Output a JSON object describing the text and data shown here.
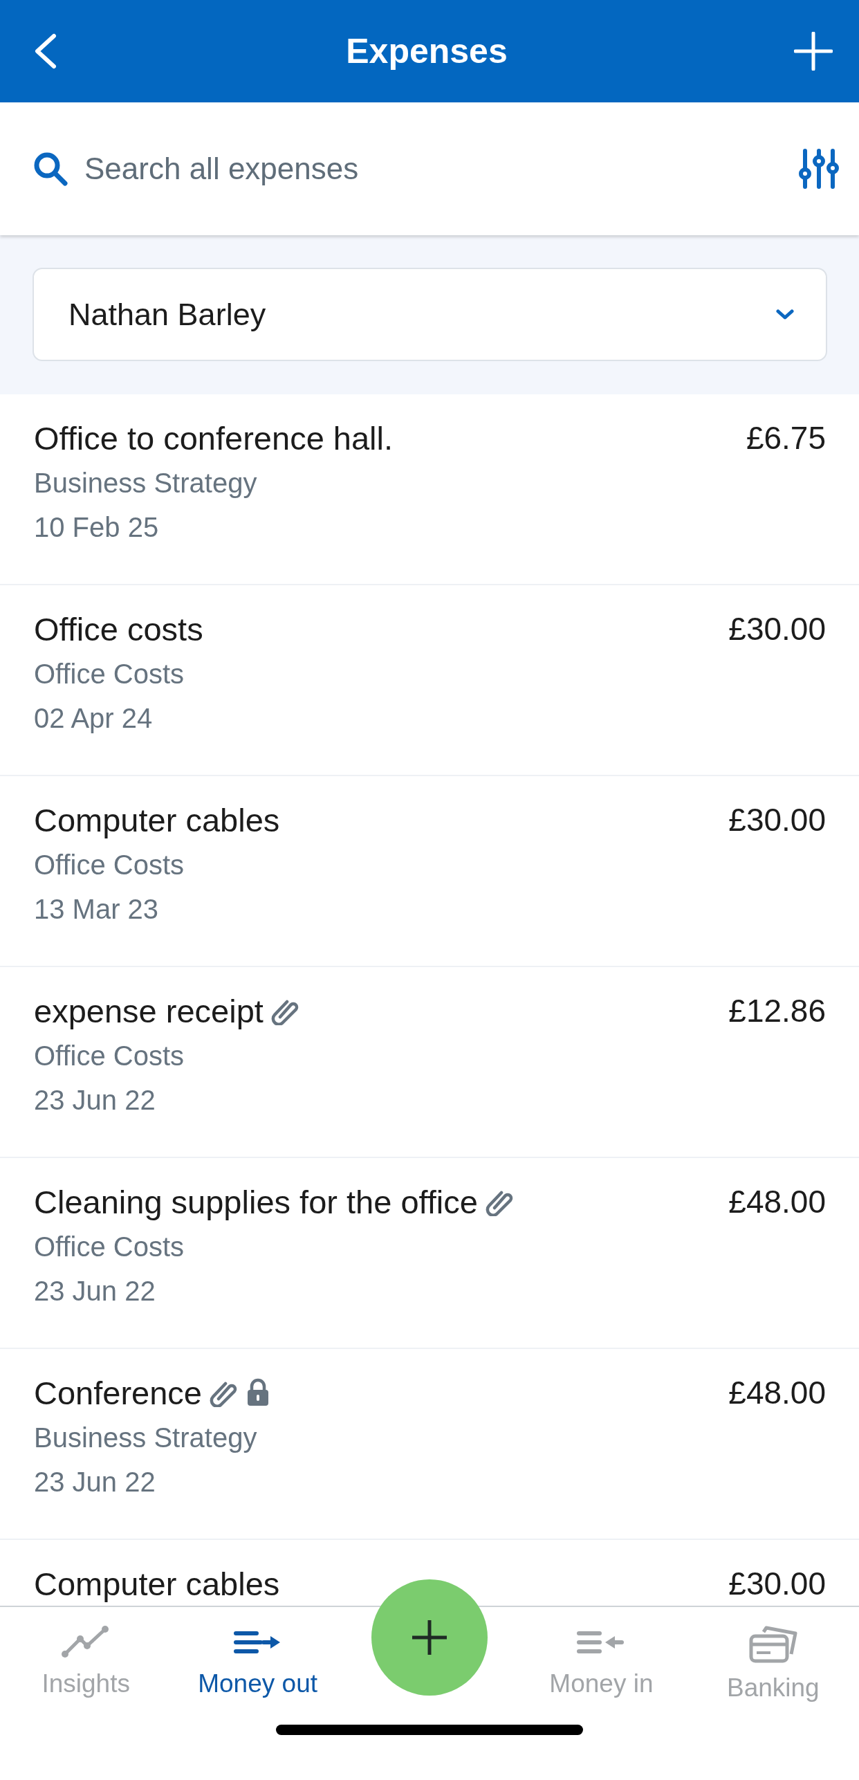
{
  "header": {
    "title": "Expenses"
  },
  "search": {
    "placeholder": "Search all expenses"
  },
  "filter": {
    "value": "Nathan Barley"
  },
  "expenses": [
    {
      "title": "Office to conference hall.",
      "category": "Business Strategy",
      "date": "10 Feb 25",
      "amount": "£6.75",
      "attachment": false,
      "locked": false
    },
    {
      "title": "Office costs",
      "category": "Office Costs",
      "date": "02 Apr 24",
      "amount": "£30.00",
      "attachment": false,
      "locked": false
    },
    {
      "title": "Computer cables",
      "category": "Office Costs",
      "date": "13 Mar 23",
      "amount": "£30.00",
      "attachment": false,
      "locked": false
    },
    {
      "title": "expense receipt",
      "category": "Office Costs",
      "date": "23 Jun 22",
      "amount": "£12.86",
      "attachment": true,
      "locked": false
    },
    {
      "title": "Cleaning supplies for the office",
      "category": "Office Costs",
      "date": "23 Jun 22",
      "amount": "£48.00",
      "attachment": true,
      "locked": false
    },
    {
      "title": "Conference",
      "category": "Business Strategy",
      "date": "23 Jun 22",
      "amount": "£48.00",
      "attachment": true,
      "locked": true
    },
    {
      "title": "Computer cables",
      "amount": "£30.00",
      "attachment": false,
      "locked": false
    }
  ],
  "nav": [
    {
      "kind": "insights",
      "label": "Insights",
      "selected": false
    },
    {
      "kind": "money-out",
      "label": "Money out",
      "selected": true
    },
    {
      "kind": "add"
    },
    {
      "kind": "money-in",
      "label": "Money in",
      "selected": false
    },
    {
      "kind": "banking",
      "label": "Banking",
      "selected": false
    }
  ]
}
